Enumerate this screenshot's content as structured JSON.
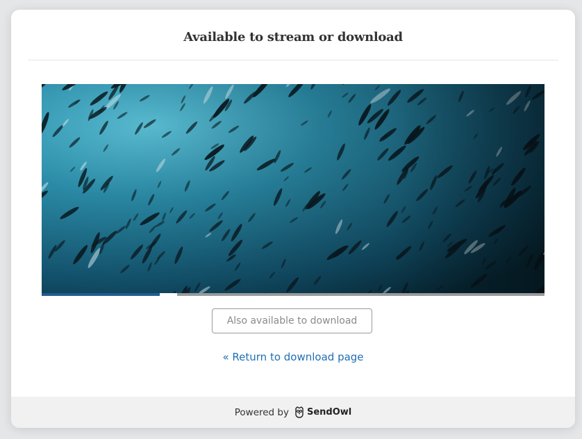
{
  "header": {
    "title": "Available to stream or download"
  },
  "player": {
    "progress_fraction": 0.235,
    "buffered_fraction": 0.27,
    "colors": {
      "water_top": "#3fa6c1",
      "water_bottom": "#0c3446",
      "fish": "#0a1a22",
      "progress": "#1f5c94"
    }
  },
  "actions": {
    "download_label": "Also available to download",
    "return_label": "« Return to download page"
  },
  "footer": {
    "powered_by": "Powered by",
    "brand": "SendOwl",
    "brand_icon": "owl-icon"
  }
}
